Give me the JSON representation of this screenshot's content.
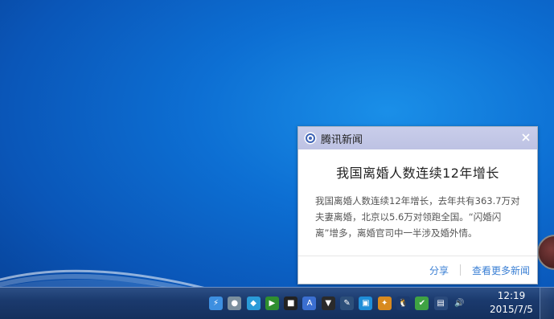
{
  "notification": {
    "app_name": "腾讯新闻",
    "headline": "我国离婚人数连续12年增长",
    "summary": "我国离婚人数连续12年增长，去年共有363.7万对夫妻离婚，北京以5.6万对领跑全国。“闪婚闪离”增多，离婚官司中一半涉及婚外情。",
    "share_label": "分享",
    "more_news_label": "查看更多新闻"
  },
  "taskbar": {
    "tray_icons": [
      "xunlei-icon",
      "user-icon",
      "shield-icon",
      "nvidia-icon",
      "cpu-icon",
      "anti-virus-icon",
      "download-icon",
      "feather-icon",
      "network-drive-icon",
      "flame-icon",
      "qq-penguin-icon",
      "security-icon",
      "network-icon",
      "volume-icon"
    ],
    "clock_time": "12:19",
    "clock_date": "2015/7/5"
  },
  "colors": {
    "header_bg": "#c9cdea",
    "link": "#3a7fd4",
    "taskbar": "#1b3a6e"
  }
}
